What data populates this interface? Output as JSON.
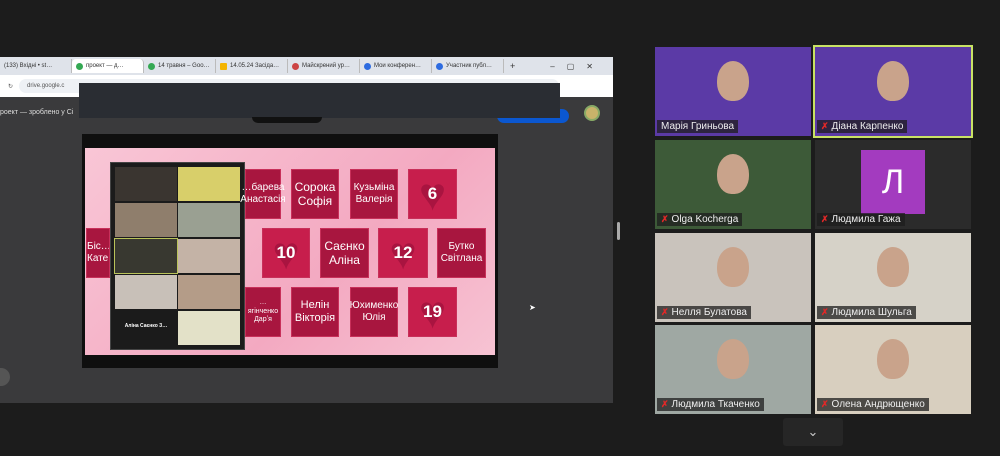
{
  "browser": {
    "tabs": [
      "(133) Вхідні • st…",
      "проект — д…",
      "14 травня – Goo…",
      "14.05.24 Засіда…",
      "Майскрений ур…",
      "Мои конферен…",
      "Участник публ…"
    ],
    "new_tab": "+",
    "url": "drive.google.c",
    "page_title": "роект — зроблено у Сі"
  },
  "slide": {
    "cards": [
      "…барева Анастасія",
      "Сорока Софія",
      "Кузьміна Валерія",
      "6",
      "Біс… Кате…",
      "10",
      "Саєнко Аліна",
      "12",
      "Бутко Світлана",
      "…ягінченко Дарʼя",
      "Нелін Вікторія",
      "Юхименко Юлія",
      "19"
    ],
    "thumb_label": "Аліна Саєнко З…"
  },
  "participants": [
    {
      "name": "Марія Гриньова",
      "muted": false,
      "bg": "#5b3aa6"
    },
    {
      "name": "Діана Карпенко",
      "muted": true,
      "bg": "#5b3aa6",
      "active": true
    },
    {
      "name": "Olga Kocherga",
      "muted": true,
      "bg": "#3d5a38"
    },
    {
      "name": "Людмила Гажа",
      "muted": true,
      "bg": "#2b2b2b",
      "initial": "Л"
    },
    {
      "name": "Нелля Булатова",
      "muted": true,
      "bg": "#c9c3bc"
    },
    {
      "name": "Людмила Шульга",
      "muted": true,
      "bg": "#d6d2c8"
    },
    {
      "name": "Людмила Ткаченко",
      "muted": true,
      "bg": "#9fa8a3"
    },
    {
      "name": "Олена Андрющенко",
      "muted": true,
      "bg": "#d8cfbf"
    }
  ],
  "controls": {
    "more_icon": "⌄"
  }
}
